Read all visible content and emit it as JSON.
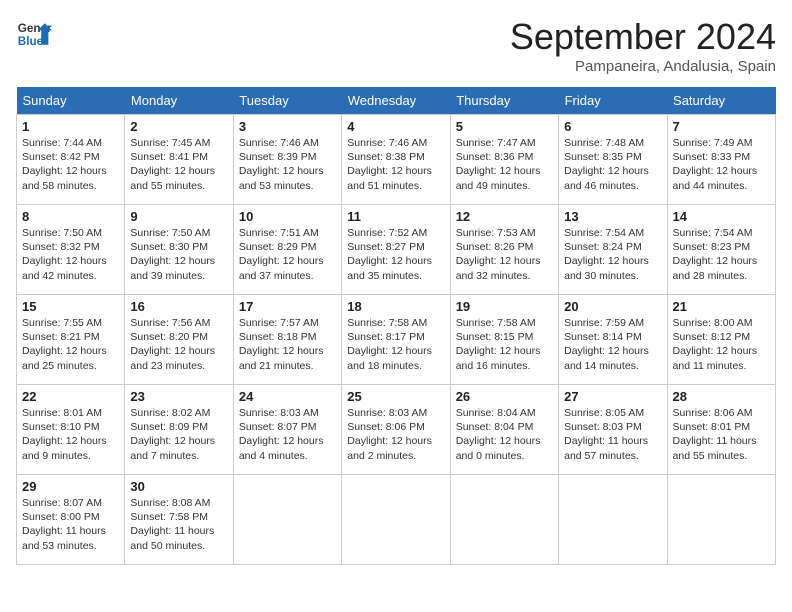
{
  "header": {
    "logo_line1": "General",
    "logo_line2": "Blue",
    "month": "September 2024",
    "location": "Pampaneira, Andalusia, Spain"
  },
  "weekdays": [
    "Sunday",
    "Monday",
    "Tuesday",
    "Wednesday",
    "Thursday",
    "Friday",
    "Saturday"
  ],
  "weeks": [
    [
      {
        "day": "1",
        "lines": [
          "Sunrise: 7:44 AM",
          "Sunset: 8:42 PM",
          "Daylight: 12 hours",
          "and 58 minutes."
        ]
      },
      {
        "day": "2",
        "lines": [
          "Sunrise: 7:45 AM",
          "Sunset: 8:41 PM",
          "Daylight: 12 hours",
          "and 55 minutes."
        ]
      },
      {
        "day": "3",
        "lines": [
          "Sunrise: 7:46 AM",
          "Sunset: 8:39 PM",
          "Daylight: 12 hours",
          "and 53 minutes."
        ]
      },
      {
        "day": "4",
        "lines": [
          "Sunrise: 7:46 AM",
          "Sunset: 8:38 PM",
          "Daylight: 12 hours",
          "and 51 minutes."
        ]
      },
      {
        "day": "5",
        "lines": [
          "Sunrise: 7:47 AM",
          "Sunset: 8:36 PM",
          "Daylight: 12 hours",
          "and 49 minutes."
        ]
      },
      {
        "day": "6",
        "lines": [
          "Sunrise: 7:48 AM",
          "Sunset: 8:35 PM",
          "Daylight: 12 hours",
          "and 46 minutes."
        ]
      },
      {
        "day": "7",
        "lines": [
          "Sunrise: 7:49 AM",
          "Sunset: 8:33 PM",
          "Daylight: 12 hours",
          "and 44 minutes."
        ]
      }
    ],
    [
      {
        "day": "8",
        "lines": [
          "Sunrise: 7:50 AM",
          "Sunset: 8:32 PM",
          "Daylight: 12 hours",
          "and 42 minutes."
        ]
      },
      {
        "day": "9",
        "lines": [
          "Sunrise: 7:50 AM",
          "Sunset: 8:30 PM",
          "Daylight: 12 hours",
          "and 39 minutes."
        ]
      },
      {
        "day": "10",
        "lines": [
          "Sunrise: 7:51 AM",
          "Sunset: 8:29 PM",
          "Daylight: 12 hours",
          "and 37 minutes."
        ]
      },
      {
        "day": "11",
        "lines": [
          "Sunrise: 7:52 AM",
          "Sunset: 8:27 PM",
          "Daylight: 12 hours",
          "and 35 minutes."
        ]
      },
      {
        "day": "12",
        "lines": [
          "Sunrise: 7:53 AM",
          "Sunset: 8:26 PM",
          "Daylight: 12 hours",
          "and 32 minutes."
        ]
      },
      {
        "day": "13",
        "lines": [
          "Sunrise: 7:54 AM",
          "Sunset: 8:24 PM",
          "Daylight: 12 hours",
          "and 30 minutes."
        ]
      },
      {
        "day": "14",
        "lines": [
          "Sunrise: 7:54 AM",
          "Sunset: 8:23 PM",
          "Daylight: 12 hours",
          "and 28 minutes."
        ]
      }
    ],
    [
      {
        "day": "15",
        "lines": [
          "Sunrise: 7:55 AM",
          "Sunset: 8:21 PM",
          "Daylight: 12 hours",
          "and 25 minutes."
        ]
      },
      {
        "day": "16",
        "lines": [
          "Sunrise: 7:56 AM",
          "Sunset: 8:20 PM",
          "Daylight: 12 hours",
          "and 23 minutes."
        ]
      },
      {
        "day": "17",
        "lines": [
          "Sunrise: 7:57 AM",
          "Sunset: 8:18 PM",
          "Daylight: 12 hours",
          "and 21 minutes."
        ]
      },
      {
        "day": "18",
        "lines": [
          "Sunrise: 7:58 AM",
          "Sunset: 8:17 PM",
          "Daylight: 12 hours",
          "and 18 minutes."
        ]
      },
      {
        "day": "19",
        "lines": [
          "Sunrise: 7:58 AM",
          "Sunset: 8:15 PM",
          "Daylight: 12 hours",
          "and 16 minutes."
        ]
      },
      {
        "day": "20",
        "lines": [
          "Sunrise: 7:59 AM",
          "Sunset: 8:14 PM",
          "Daylight: 12 hours",
          "and 14 minutes."
        ]
      },
      {
        "day": "21",
        "lines": [
          "Sunrise: 8:00 AM",
          "Sunset: 8:12 PM",
          "Daylight: 12 hours",
          "and 11 minutes."
        ]
      }
    ],
    [
      {
        "day": "22",
        "lines": [
          "Sunrise: 8:01 AM",
          "Sunset: 8:10 PM",
          "Daylight: 12 hours",
          "and 9 minutes."
        ]
      },
      {
        "day": "23",
        "lines": [
          "Sunrise: 8:02 AM",
          "Sunset: 8:09 PM",
          "Daylight: 12 hours",
          "and 7 minutes."
        ]
      },
      {
        "day": "24",
        "lines": [
          "Sunrise: 8:03 AM",
          "Sunset: 8:07 PM",
          "Daylight: 12 hours",
          "and 4 minutes."
        ]
      },
      {
        "day": "25",
        "lines": [
          "Sunrise: 8:03 AM",
          "Sunset: 8:06 PM",
          "Daylight: 12 hours",
          "and 2 minutes."
        ]
      },
      {
        "day": "26",
        "lines": [
          "Sunrise: 8:04 AM",
          "Sunset: 8:04 PM",
          "Daylight: 12 hours",
          "and 0 minutes."
        ]
      },
      {
        "day": "27",
        "lines": [
          "Sunrise: 8:05 AM",
          "Sunset: 8:03 PM",
          "Daylight: 11 hours",
          "and 57 minutes."
        ]
      },
      {
        "day": "28",
        "lines": [
          "Sunrise: 8:06 AM",
          "Sunset: 8:01 PM",
          "Daylight: 11 hours",
          "and 55 minutes."
        ]
      }
    ],
    [
      {
        "day": "29",
        "lines": [
          "Sunrise: 8:07 AM",
          "Sunset: 8:00 PM",
          "Daylight: 11 hours",
          "and 53 minutes."
        ]
      },
      {
        "day": "30",
        "lines": [
          "Sunrise: 8:08 AM",
          "Sunset: 7:58 PM",
          "Daylight: 11 hours",
          "and 50 minutes."
        ]
      },
      {
        "day": "",
        "lines": []
      },
      {
        "day": "",
        "lines": []
      },
      {
        "day": "",
        "lines": []
      },
      {
        "day": "",
        "lines": []
      },
      {
        "day": "",
        "lines": []
      }
    ]
  ]
}
